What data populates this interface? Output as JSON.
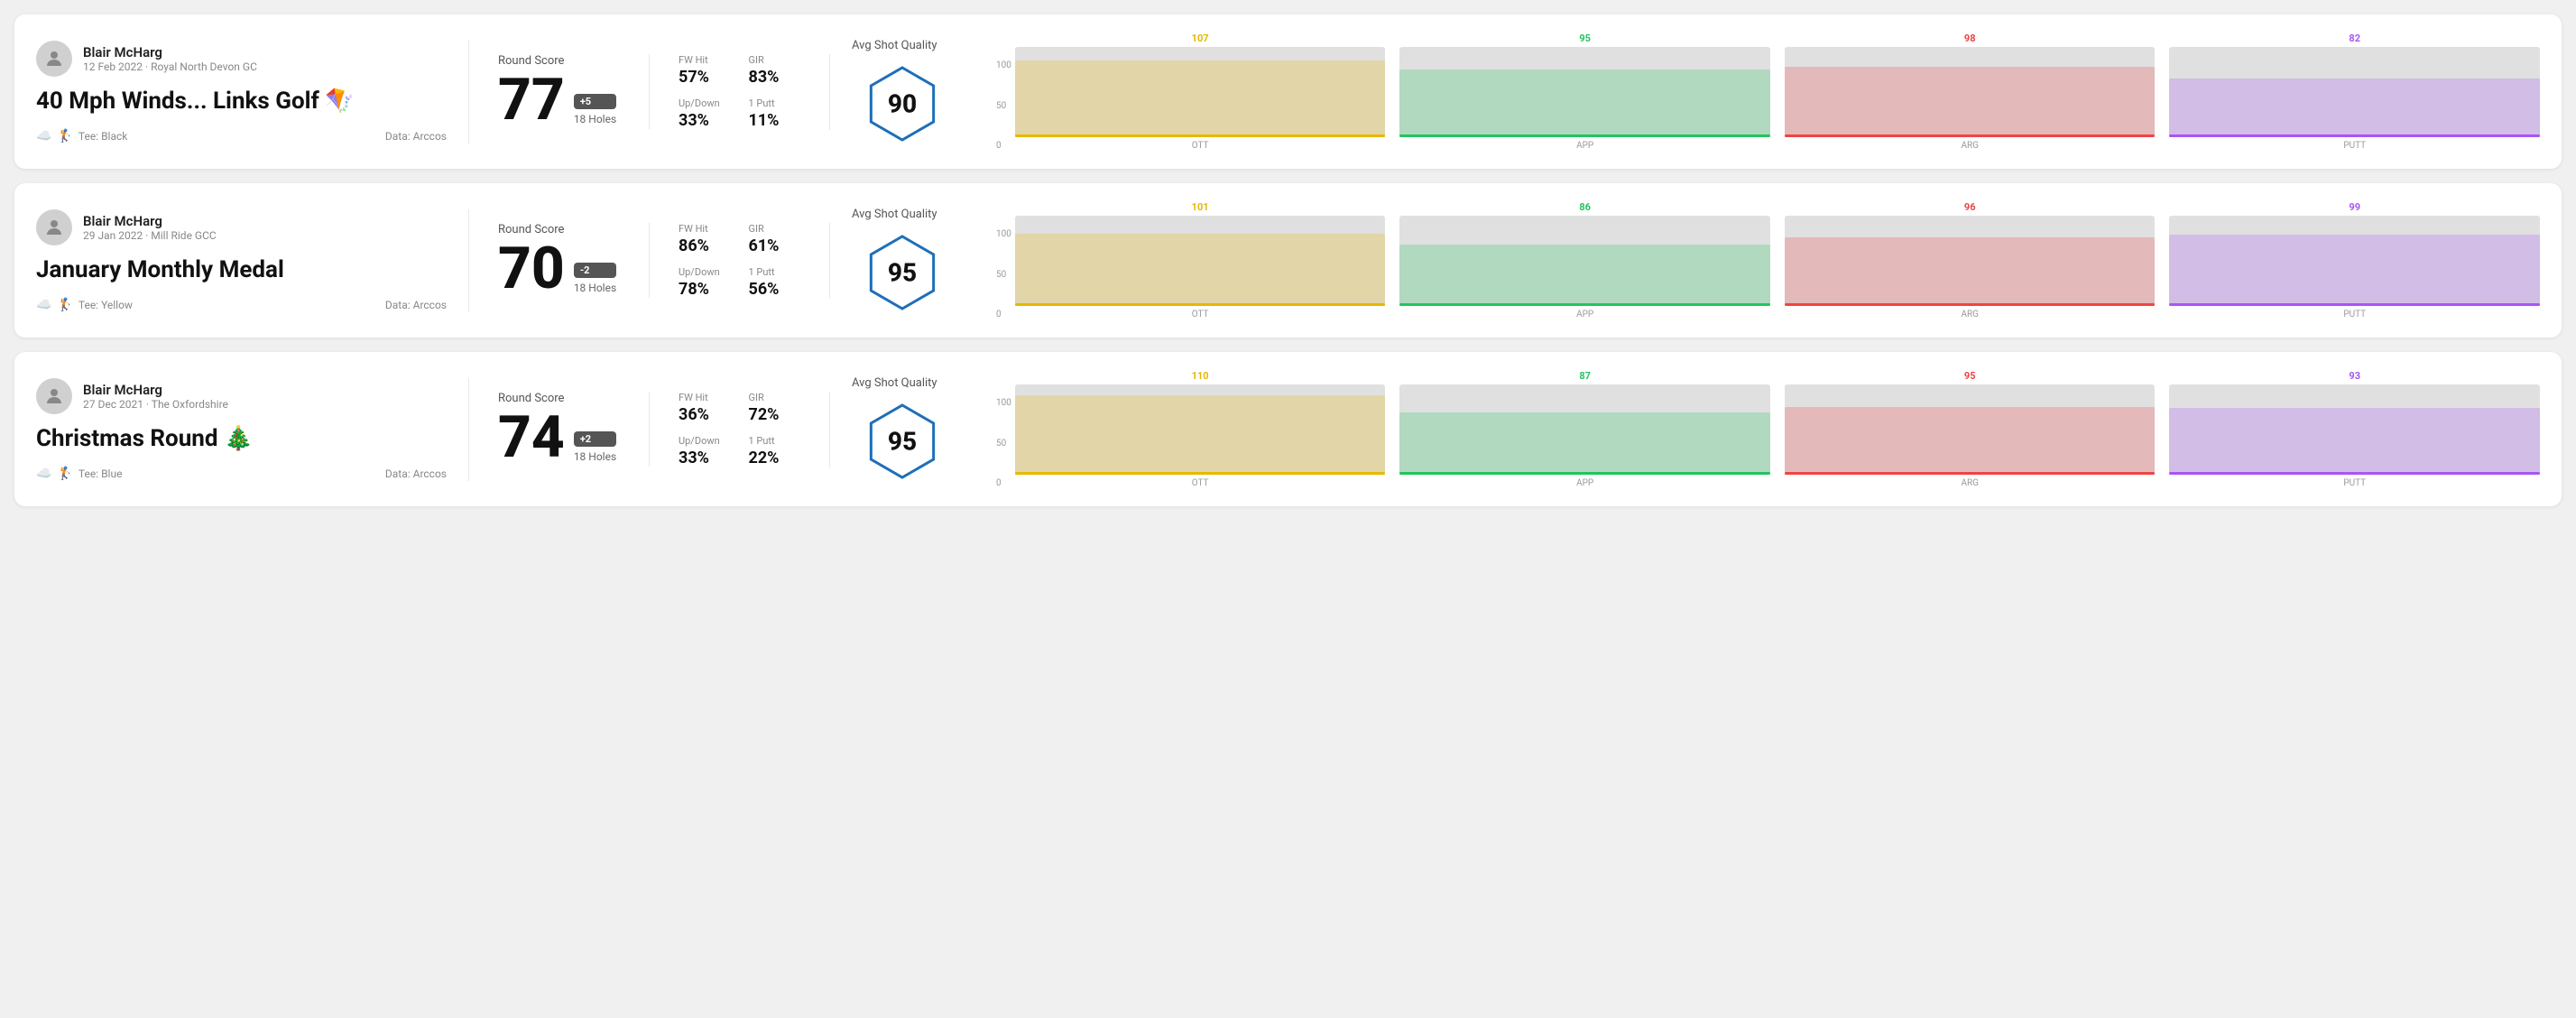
{
  "rounds": [
    {
      "id": "round1",
      "player_name": "Blair McHarg",
      "date_course": "12 Feb 2022 · Royal North Devon GC",
      "title": "40 Mph Winds... Links Golf 🪁",
      "tee": "Black",
      "data_source": "Data: Arccos",
      "score": "77",
      "score_diff": "+5",
      "score_holes": "18 Holes",
      "fw_hit": "57%",
      "gir": "83%",
      "up_down": "33%",
      "one_putt": "11%",
      "avg_quality": "90",
      "chart": {
        "ott": {
          "value": 107,
          "color": "#e6b800",
          "height_pct": 85
        },
        "app": {
          "value": 95,
          "color": "#22c55e",
          "height_pct": 75
        },
        "arg": {
          "value": 98,
          "color": "#ef4444",
          "height_pct": 78
        },
        "putt": {
          "value": 82,
          "color": "#a855f7",
          "height_pct": 65
        }
      }
    },
    {
      "id": "round2",
      "player_name": "Blair McHarg",
      "date_course": "29 Jan 2022 · Mill Ride GCC",
      "title": "January Monthly Medal",
      "tee": "Yellow",
      "data_source": "Data: Arccos",
      "score": "70",
      "score_diff": "-2",
      "score_holes": "18 Holes",
      "fw_hit": "86%",
      "gir": "61%",
      "up_down": "78%",
      "one_putt": "56%",
      "avg_quality": "95",
      "chart": {
        "ott": {
          "value": 101,
          "color": "#e6b800",
          "height_pct": 80
        },
        "app": {
          "value": 86,
          "color": "#22c55e",
          "height_pct": 68
        },
        "arg": {
          "value": 96,
          "color": "#ef4444",
          "height_pct": 76
        },
        "putt": {
          "value": 99,
          "color": "#a855f7",
          "height_pct": 79
        }
      }
    },
    {
      "id": "round3",
      "player_name": "Blair McHarg",
      "date_course": "27 Dec 2021 · The Oxfordshire",
      "title": "Christmas Round 🎄",
      "tee": "Blue",
      "data_source": "Data: Arccos",
      "score": "74",
      "score_diff": "+2",
      "score_holes": "18 Holes",
      "fw_hit": "36%",
      "gir": "72%",
      "up_down": "33%",
      "one_putt": "22%",
      "avg_quality": "95",
      "chart": {
        "ott": {
          "value": 110,
          "color": "#e6b800",
          "height_pct": 88
        },
        "app": {
          "value": 87,
          "color": "#22c55e",
          "height_pct": 69
        },
        "arg": {
          "value": 95,
          "color": "#ef4444",
          "height_pct": 75
        },
        "putt": {
          "value": 93,
          "color": "#a855f7",
          "height_pct": 74
        }
      }
    }
  ],
  "labels": {
    "round_score": "Round Score",
    "fw_hit": "FW Hit",
    "gir": "GIR",
    "up_down": "Up/Down",
    "one_putt": "1 Putt",
    "avg_quality": "Avg Shot Quality",
    "y_axis": [
      "100",
      "50",
      "0"
    ],
    "x_axis": [
      "OTT",
      "APP",
      "ARG",
      "PUTT"
    ]
  }
}
